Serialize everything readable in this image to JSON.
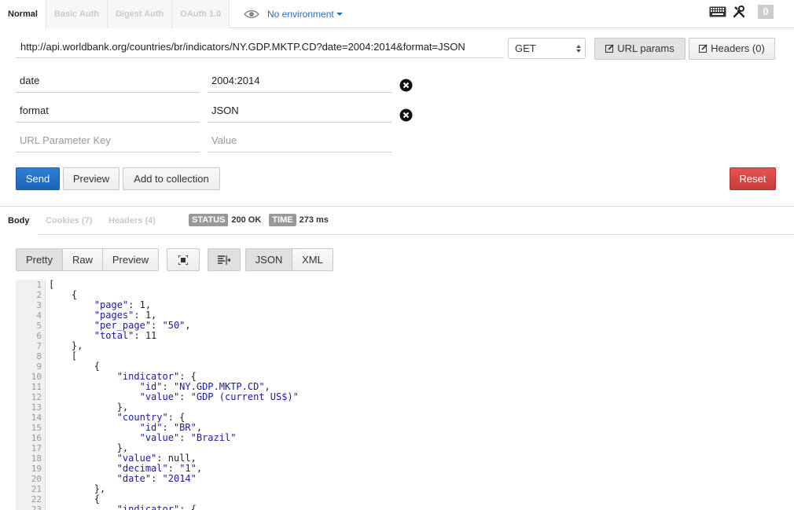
{
  "auth_tabs": [
    "Normal",
    "Basic Auth",
    "Digest Auth",
    "OAuth 1.0"
  ],
  "environment": {
    "label": "No environment"
  },
  "counter": "0",
  "request": {
    "url": "http://api.worldbank.org/countries/br/indicators/NY.GDP.MKTP.CD?date=2004:2014&format=JSON",
    "method": "GET",
    "url_params_label": "URL params",
    "headers_label": "Headers (0)"
  },
  "params": [
    {
      "key": "date",
      "value": "2004:2014"
    },
    {
      "key": "format",
      "value": "JSON"
    }
  ],
  "new_param": {
    "key_placeholder": "URL Parameter Key",
    "value_placeholder": "Value"
  },
  "actions": {
    "send": "Send",
    "preview": "Preview",
    "add_to_collection": "Add to collection",
    "reset": "Reset"
  },
  "colors": {
    "send": "#1f6fc8",
    "reset": "#d64545",
    "json_key": "#1a1aa6"
  },
  "response": {
    "tabs": [
      "Body",
      "Cookies (7)",
      "Headers (4)"
    ],
    "status_tag": "STATUS",
    "status_value": "200 OK",
    "time_tag": "TIME",
    "time_value": "273 ms"
  },
  "view_modes": [
    "Pretty",
    "Raw",
    "Preview"
  ],
  "formats": [
    "JSON",
    "XML"
  ],
  "code_lines": [
    "[",
    "    {",
    "        \"page\": 1,",
    "        \"pages\": 1,",
    "        \"per_page\": \"50\",",
    "        \"total\": 11",
    "    },",
    "    [",
    "        {",
    "            \"indicator\": {",
    "                \"id\": \"NY.GDP.MKTP.CD\",",
    "                \"value\": \"GDP (current US$)\"",
    "            },",
    "            \"country\": {",
    "                \"id\": \"BR\",",
    "                \"value\": \"Brazil\"",
    "            },",
    "            \"value\": null,",
    "            \"decimal\": \"1\",",
    "            \"date\": \"2014\"",
    "        },",
    "        {",
    "            \"indicator\": {"
  ]
}
